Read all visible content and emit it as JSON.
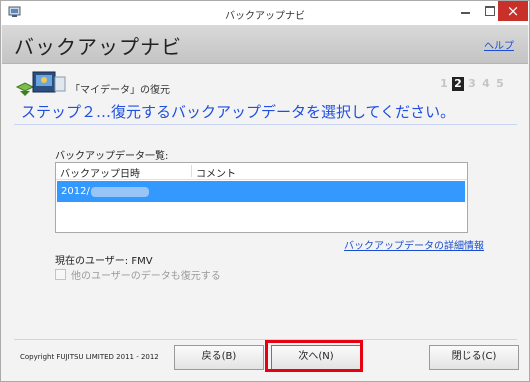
{
  "window": {
    "title": "バックアップナビ",
    "controls": {
      "minimize": "–",
      "maximize": "□",
      "close": "×"
    }
  },
  "header": {
    "title": "バックアップナビ",
    "help_link": "ヘルプ"
  },
  "step": {
    "caption": "「マイデータ」の復元",
    "numbers": [
      "1",
      "2",
      "3",
      "4",
      "5"
    ],
    "active": "2",
    "heading": "ステップ２…復元するバックアップデータを選択してください。"
  },
  "backup_list": {
    "label": "バックアップデータ一覧:",
    "columns": [
      "バックアップ日時",
      "コメント"
    ],
    "rows": [
      {
        "date": "2012/",
        "comment": "",
        "selected": true
      }
    ],
    "details_link": "バックアップデータの詳細情報"
  },
  "user": {
    "current": "現在のユーザー: FMV",
    "restore_others": "他のユーザーのデータも復元する",
    "restore_others_checked": false
  },
  "footer": {
    "copyright": "Copyright FUJITSU LIMITED 2011 - 2012",
    "back_button": "戻る(B)",
    "next_button": "次へ(N)",
    "close_button": "閉じる(C)"
  },
  "colors": {
    "heading": "#1f4fe0",
    "link": "#1a4ed0",
    "selection": "#3399ff",
    "highlight": "#e60012",
    "close_button": "#c7312a"
  },
  "icons": [
    "app-icon",
    "restore-data-icon"
  ]
}
